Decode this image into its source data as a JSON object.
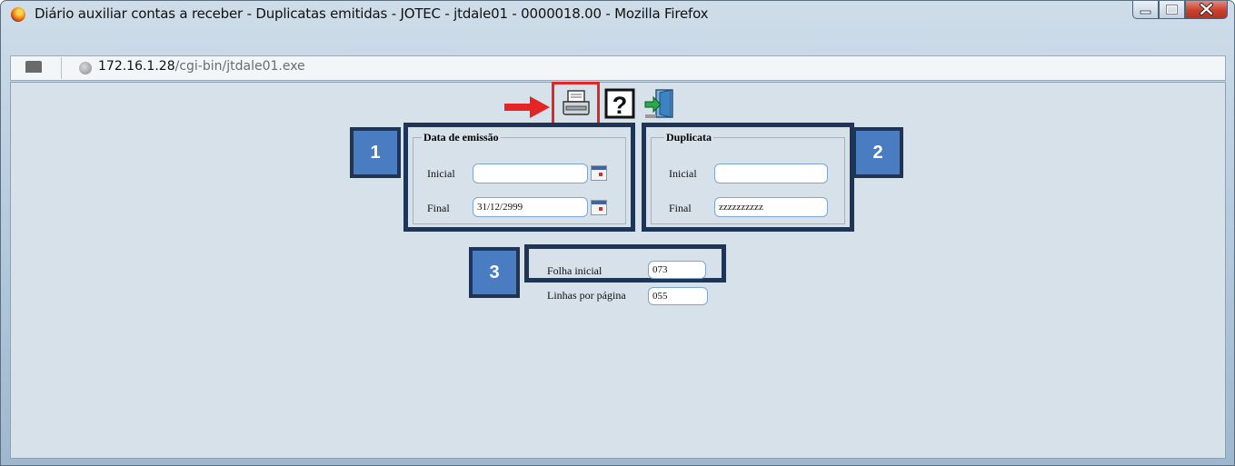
{
  "window": {
    "title": "Diário auxiliar contas a receber - Duplicatas emitidas - JOTEC - jtdale01 - 0000018.00 - Mozilla Firefox"
  },
  "address": {
    "host": "172.16.1.28",
    "path": "/cgi-bin/jtdale01.exe"
  },
  "toolbar": {
    "icons": [
      "printer-icon",
      "help-icon",
      "exit-icon"
    ]
  },
  "data_emissao": {
    "legend": "Data de emissão",
    "inicial_label": "Inicial",
    "inicial_value": "",
    "final_label": "Final",
    "final_value": "31/12/2999"
  },
  "duplicata": {
    "legend": "Duplicata",
    "inicial_label": "Inicial",
    "inicial_value": "",
    "final_label": "Final",
    "final_value": "zzzzzzzzzz"
  },
  "paginacao": {
    "folha_label": "Folha inicial",
    "folha_value": "073",
    "linhas_label": "Linhas por página",
    "linhas_value": "055"
  },
  "badges": [
    "1",
    "2",
    "3"
  ],
  "colors": {
    "highlight": "#e52426",
    "badge_fill": "#4a7cc2",
    "badge_border": "#1f3556",
    "content_bg": "#d6e1e9"
  }
}
